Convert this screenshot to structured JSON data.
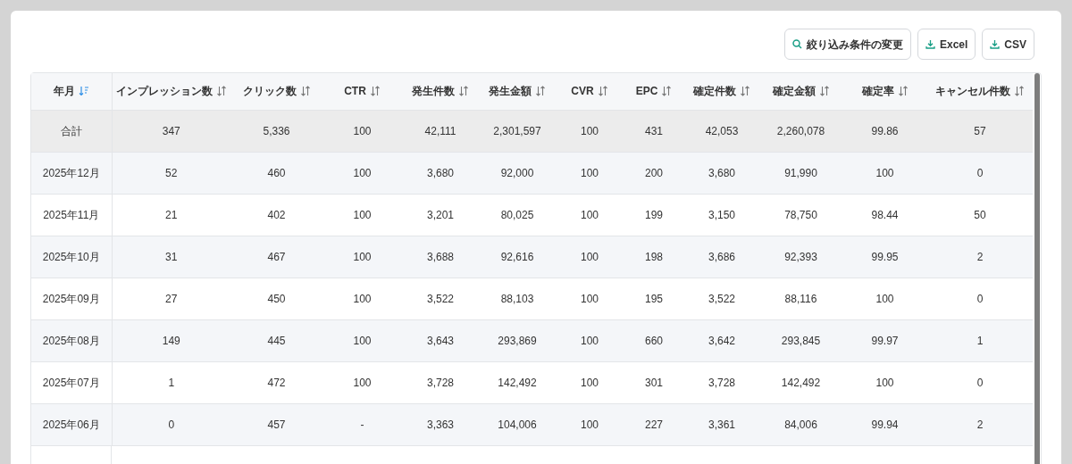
{
  "toolbar": {
    "buttons": [
      {
        "kind": "filter",
        "label": "絞り込み条件の変更"
      },
      {
        "kind": "download",
        "label": "Excel"
      },
      {
        "kind": "download",
        "label": "CSV"
      }
    ]
  },
  "table": {
    "columns": [
      {
        "label": "年月",
        "sort_active": true
      },
      {
        "label": "インプレッション数",
        "sort_active": false
      },
      {
        "label": "クリック数",
        "sort_active": false
      },
      {
        "label": "CTR",
        "sort_active": false
      },
      {
        "label": "発生件数",
        "sort_active": false
      },
      {
        "label": "発生金額",
        "sort_active": false
      },
      {
        "label": "CVR",
        "sort_active": false
      },
      {
        "label": "EPC",
        "sort_active": false
      },
      {
        "label": "確定件数",
        "sort_active": false
      },
      {
        "label": "確定金額",
        "sort_active": false
      },
      {
        "label": "確定率",
        "sort_active": false
      },
      {
        "label": "キャンセル件数",
        "sort_active": false
      }
    ],
    "rows": [
      {
        "kind": "total",
        "cells": [
          "合計",
          "347",
          "5,336",
          "100",
          "42,111",
          "2,301,597",
          "100",
          "431",
          "42,053",
          "2,260,078",
          "99.86",
          "57"
        ]
      },
      {
        "kind": "month",
        "cells": [
          "2025年12月",
          "52",
          "460",
          "100",
          "3,680",
          "92,000",
          "100",
          "200",
          "3,680",
          "91,990",
          "100",
          "0"
        ]
      },
      {
        "kind": "month",
        "cells": [
          "2025年11月",
          "21",
          "402",
          "100",
          "3,201",
          "80,025",
          "100",
          "199",
          "3,150",
          "78,750",
          "98.44",
          "50"
        ]
      },
      {
        "kind": "month",
        "cells": [
          "2025年10月",
          "31",
          "467",
          "100",
          "3,688",
          "92,616",
          "100",
          "198",
          "3,686",
          "92,393",
          "99.95",
          "2"
        ]
      },
      {
        "kind": "month",
        "cells": [
          "2025年09月",
          "27",
          "450",
          "100",
          "3,522",
          "88,103",
          "100",
          "195",
          "3,522",
          "88,116",
          "100",
          "0"
        ]
      },
      {
        "kind": "month",
        "cells": [
          "2025年08月",
          "149",
          "445",
          "100",
          "3,643",
          "293,869",
          "100",
          "660",
          "3,642",
          "293,845",
          "99.97",
          "1"
        ]
      },
      {
        "kind": "month",
        "cells": [
          "2025年07月",
          "1",
          "472",
          "100",
          "3,728",
          "142,492",
          "100",
          "301",
          "3,728",
          "142,492",
          "100",
          "0"
        ]
      },
      {
        "kind": "month",
        "cells": [
          "2025年06月",
          "0",
          "457",
          "-",
          "3,363",
          "104,006",
          "100",
          "227",
          "3,361",
          "84,006",
          "99.94",
          "2"
        ]
      }
    ]
  }
}
